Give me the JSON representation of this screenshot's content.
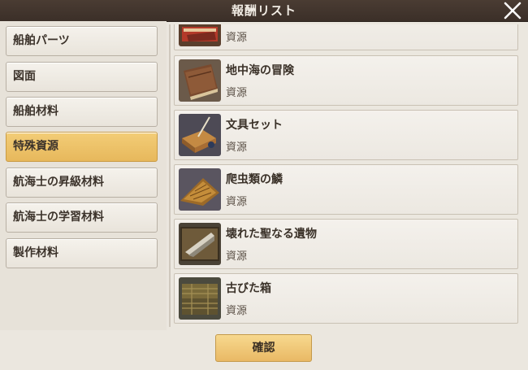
{
  "window": {
    "title": "報酬リスト",
    "close_icon": "close-icon"
  },
  "categories": [
    {
      "label": "船舶パーツ",
      "active": false
    },
    {
      "label": "図面",
      "active": false
    },
    {
      "label": "船舶材料",
      "active": false
    },
    {
      "label": "特殊資源",
      "active": true
    },
    {
      "label": "航海士の昇級材料",
      "active": false
    },
    {
      "label": "航海士の学習材料",
      "active": false
    },
    {
      "label": "製作材料",
      "active": false
    }
  ],
  "items": [
    {
      "name": "",
      "type": "資源",
      "icon": "red-book-icon"
    },
    {
      "name": "地中海の冒険",
      "type": "資源",
      "icon": "book-icon"
    },
    {
      "name": "文具セット",
      "type": "資源",
      "icon": "stationery-set-icon"
    },
    {
      "name": "爬虫類の鱗",
      "type": "資源",
      "icon": "reptile-scale-icon"
    },
    {
      "name": "壊れた聖なる遺物",
      "type": "資源",
      "icon": "broken-relic-icon"
    },
    {
      "name": "古びた箱",
      "type": "資源",
      "icon": "old-box-icon"
    }
  ],
  "footer": {
    "confirm_label": "確認"
  },
  "colors": {
    "titlebar": "#3b2f28",
    "active_category": "#eec26b",
    "confirm_button": "#f0c876",
    "panel": "#ebe7df"
  }
}
